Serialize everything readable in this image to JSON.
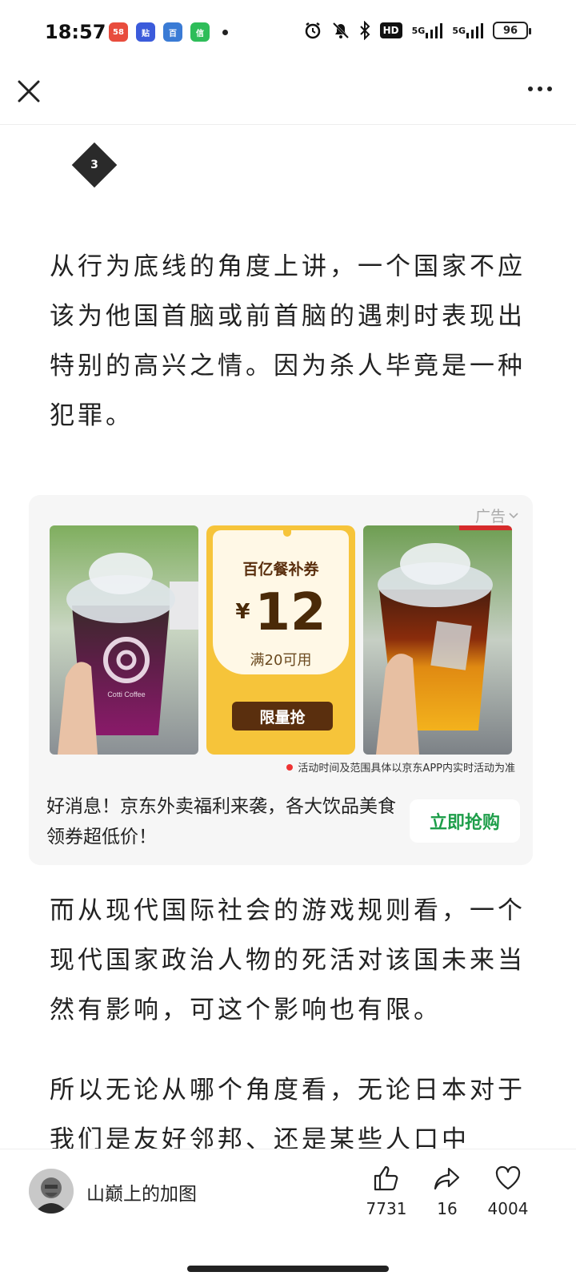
{
  "status_bar": {
    "time": "18:57",
    "apps": [
      {
        "name": "58",
        "color": "#e84c3d"
      },
      {
        "name": "贴",
        "color": "#3b5bdb"
      },
      {
        "name": "百",
        "color": "#3a7bd5"
      },
      {
        "name": "信",
        "color": "#2ebd59"
      }
    ],
    "network_1": "5G",
    "network_2": "5G",
    "hd_label": "HD",
    "battery": "96"
  },
  "section": {
    "number": "3"
  },
  "paragraphs": {
    "p1": "从行为底线的角度上讲，一个国家不应该为他国首脑或前首脑的遇刺时表现出特别的高兴之情。因为杀人毕竟是一种犯罪。",
    "p2": "而从现代国际社会的游戏规则看，一个现代国家政治人物的死活对该国未来当然有影响，可这个影响也有限。",
    "p3": "所以无论从哪个角度看，无论日本对于我们是友好邻邦、还是某些人口中"
  },
  "ad": {
    "label": "广告",
    "coupon_title": "百亿餐补券",
    "coupon_currency": "¥",
    "coupon_amount": "12",
    "coupon_condition": "满20可用",
    "coupon_button": "限量抢",
    "cup_brand": "Cotti Coffee",
    "disclaimer": "活动时间及范围具体以京东APP内实时活动为准",
    "description": "好消息！京东外卖福利来袭，各大饮品美食领券超低价！",
    "cta": "立即抢购",
    "cta_color": "#1e9e4a"
  },
  "bottom_bar": {
    "author": "山巅上的加图",
    "likes": "7731",
    "shares": "16",
    "favorites": "4004"
  }
}
